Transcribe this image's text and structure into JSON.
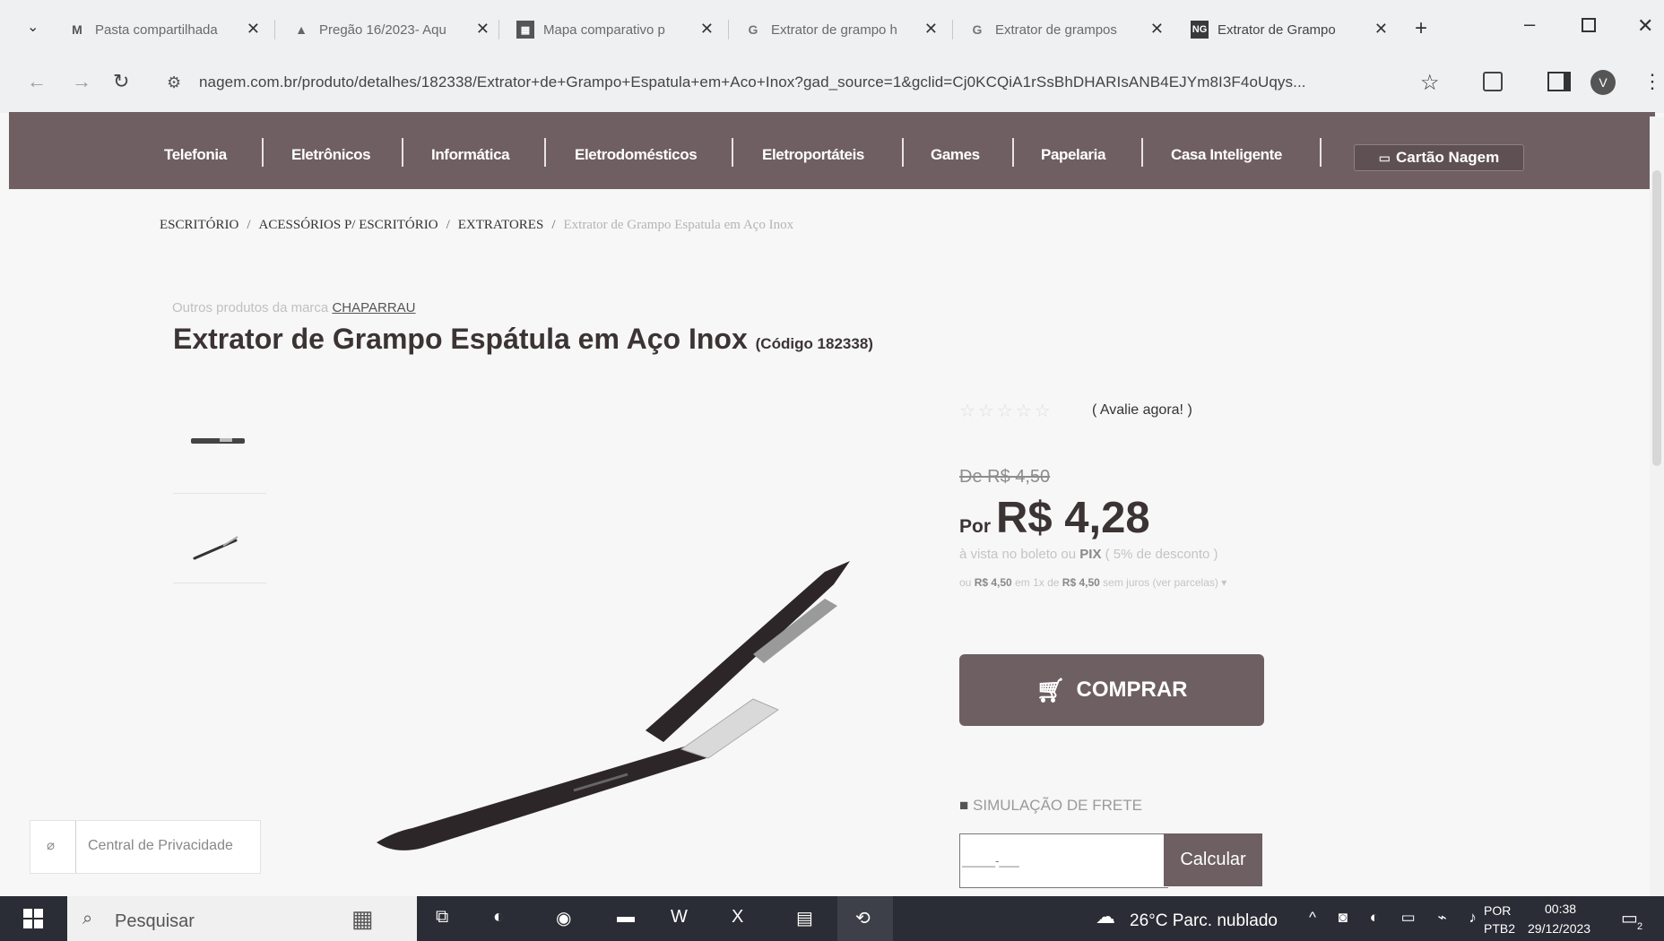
{
  "browser": {
    "tabs": [
      {
        "icon": "gmail-icon",
        "label": "Pasta compartilhada"
      },
      {
        "icon": "drive-icon",
        "label": "Pregão 16/2023- Aqu"
      },
      {
        "icon": "sheets-icon",
        "label": "Mapa comparativo p"
      },
      {
        "icon": "google-icon",
        "label": "Extrator de grampo h"
      },
      {
        "icon": "google-icon",
        "label": "Extrator de grampos"
      },
      {
        "icon": "nagem-icon",
        "label": "Extrator de Grampo"
      }
    ],
    "url": "nagem.com.br/produto/detalhes/182338/Extrator+de+Grampo+Espatula+em+Aco+Inox?gad_source=1&gclid=Cj0KCQiA1rSsBhDHARIsANB4EJYm8I3F4oUqys...",
    "profile_initial": "V"
  },
  "site_nav": {
    "items": [
      "Telefonia",
      "Eletrônicos",
      "Informática",
      "Eletrodomésticos",
      "Eletroportáteis",
      "Games",
      "Papelaria",
      "Casa Inteligente"
    ],
    "card_label": "Cartão Nagem"
  },
  "breadcrumb": {
    "items": [
      "ESCRITÓRIO",
      "ACESSÓRIOS P/ ESCRITÓRIO",
      "EXTRATORES"
    ],
    "current": "Extrator de Grampo Espatula em Aço Inox"
  },
  "product": {
    "brand_prefix": "Outros produtos da marca",
    "brand": "CHAPARRAU",
    "title": "Extrator de Grampo Espátula em Aço Inox",
    "code": "(Código 182338)",
    "rating_link": "( Avalie agora! )",
    "old_price": "De R$ 4,50",
    "price_prefix": "Por",
    "price": "R$ 4,28",
    "pix_pre": "à vista no boleto ou",
    "pix_bold": "PIX",
    "pix_post": "( 5% de desconto )",
    "installments_pre": "ou",
    "installments_amount": "R$ 4,50",
    "installments_mid": "em 1x de",
    "installments_each": "R$ 4,50",
    "installments_post": "sem juros (ver parcelas)",
    "buy_label": "COMPRAR",
    "shipping_label": "SIMULAÇÃO DE FRETE",
    "cep_placeholder": "_____-___",
    "calc_label": "Calcular"
  },
  "privacy_label": "Central de Privacidade",
  "taskbar": {
    "search_placeholder": "Pesquisar",
    "weather": "26°C  Parc. nublado",
    "lang_top": "POR",
    "lang_bottom": "PTB2",
    "time": "00:38",
    "date": "29/12/2023",
    "notif_count": "2"
  }
}
